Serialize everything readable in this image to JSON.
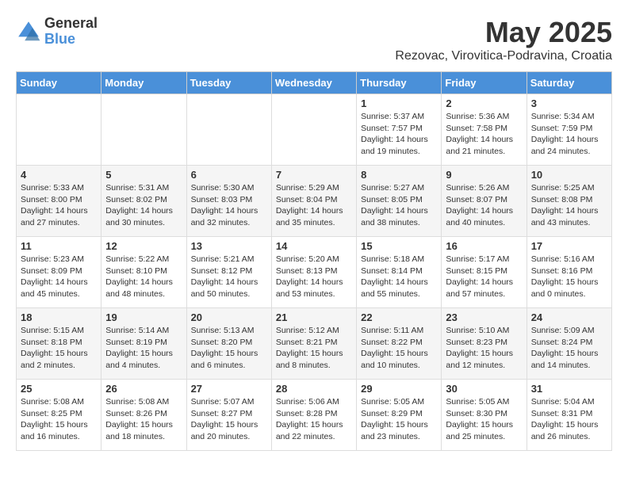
{
  "logo": {
    "general": "General",
    "blue": "Blue"
  },
  "title": "May 2025",
  "subtitle": "Rezovac, Virovitica-Podravina, Croatia",
  "headers": [
    "Sunday",
    "Monday",
    "Tuesday",
    "Wednesday",
    "Thursday",
    "Friday",
    "Saturday"
  ],
  "weeks": [
    [
      {
        "day": "",
        "info": ""
      },
      {
        "day": "",
        "info": ""
      },
      {
        "day": "",
        "info": ""
      },
      {
        "day": "",
        "info": ""
      },
      {
        "day": "1",
        "info": "Sunrise: 5:37 AM\nSunset: 7:57 PM\nDaylight: 14 hours\nand 19 minutes."
      },
      {
        "day": "2",
        "info": "Sunrise: 5:36 AM\nSunset: 7:58 PM\nDaylight: 14 hours\nand 21 minutes."
      },
      {
        "day": "3",
        "info": "Sunrise: 5:34 AM\nSunset: 7:59 PM\nDaylight: 14 hours\nand 24 minutes."
      }
    ],
    [
      {
        "day": "4",
        "info": "Sunrise: 5:33 AM\nSunset: 8:00 PM\nDaylight: 14 hours\nand 27 minutes."
      },
      {
        "day": "5",
        "info": "Sunrise: 5:31 AM\nSunset: 8:02 PM\nDaylight: 14 hours\nand 30 minutes."
      },
      {
        "day": "6",
        "info": "Sunrise: 5:30 AM\nSunset: 8:03 PM\nDaylight: 14 hours\nand 32 minutes."
      },
      {
        "day": "7",
        "info": "Sunrise: 5:29 AM\nSunset: 8:04 PM\nDaylight: 14 hours\nand 35 minutes."
      },
      {
        "day": "8",
        "info": "Sunrise: 5:27 AM\nSunset: 8:05 PM\nDaylight: 14 hours\nand 38 minutes."
      },
      {
        "day": "9",
        "info": "Sunrise: 5:26 AM\nSunset: 8:07 PM\nDaylight: 14 hours\nand 40 minutes."
      },
      {
        "day": "10",
        "info": "Sunrise: 5:25 AM\nSunset: 8:08 PM\nDaylight: 14 hours\nand 43 minutes."
      }
    ],
    [
      {
        "day": "11",
        "info": "Sunrise: 5:23 AM\nSunset: 8:09 PM\nDaylight: 14 hours\nand 45 minutes."
      },
      {
        "day": "12",
        "info": "Sunrise: 5:22 AM\nSunset: 8:10 PM\nDaylight: 14 hours\nand 48 minutes."
      },
      {
        "day": "13",
        "info": "Sunrise: 5:21 AM\nSunset: 8:12 PM\nDaylight: 14 hours\nand 50 minutes."
      },
      {
        "day": "14",
        "info": "Sunrise: 5:20 AM\nSunset: 8:13 PM\nDaylight: 14 hours\nand 53 minutes."
      },
      {
        "day": "15",
        "info": "Sunrise: 5:18 AM\nSunset: 8:14 PM\nDaylight: 14 hours\nand 55 minutes."
      },
      {
        "day": "16",
        "info": "Sunrise: 5:17 AM\nSunset: 8:15 PM\nDaylight: 14 hours\nand 57 minutes."
      },
      {
        "day": "17",
        "info": "Sunrise: 5:16 AM\nSunset: 8:16 PM\nDaylight: 15 hours\nand 0 minutes."
      }
    ],
    [
      {
        "day": "18",
        "info": "Sunrise: 5:15 AM\nSunset: 8:18 PM\nDaylight: 15 hours\nand 2 minutes."
      },
      {
        "day": "19",
        "info": "Sunrise: 5:14 AM\nSunset: 8:19 PM\nDaylight: 15 hours\nand 4 minutes."
      },
      {
        "day": "20",
        "info": "Sunrise: 5:13 AM\nSunset: 8:20 PM\nDaylight: 15 hours\nand 6 minutes."
      },
      {
        "day": "21",
        "info": "Sunrise: 5:12 AM\nSunset: 8:21 PM\nDaylight: 15 hours\nand 8 minutes."
      },
      {
        "day": "22",
        "info": "Sunrise: 5:11 AM\nSunset: 8:22 PM\nDaylight: 15 hours\nand 10 minutes."
      },
      {
        "day": "23",
        "info": "Sunrise: 5:10 AM\nSunset: 8:23 PM\nDaylight: 15 hours\nand 12 minutes."
      },
      {
        "day": "24",
        "info": "Sunrise: 5:09 AM\nSunset: 8:24 PM\nDaylight: 15 hours\nand 14 minutes."
      }
    ],
    [
      {
        "day": "25",
        "info": "Sunrise: 5:08 AM\nSunset: 8:25 PM\nDaylight: 15 hours\nand 16 minutes."
      },
      {
        "day": "26",
        "info": "Sunrise: 5:08 AM\nSunset: 8:26 PM\nDaylight: 15 hours\nand 18 minutes."
      },
      {
        "day": "27",
        "info": "Sunrise: 5:07 AM\nSunset: 8:27 PM\nDaylight: 15 hours\nand 20 minutes."
      },
      {
        "day": "28",
        "info": "Sunrise: 5:06 AM\nSunset: 8:28 PM\nDaylight: 15 hours\nand 22 minutes."
      },
      {
        "day": "29",
        "info": "Sunrise: 5:05 AM\nSunset: 8:29 PM\nDaylight: 15 hours\nand 23 minutes."
      },
      {
        "day": "30",
        "info": "Sunrise: 5:05 AM\nSunset: 8:30 PM\nDaylight: 15 hours\nand 25 minutes."
      },
      {
        "day": "31",
        "info": "Sunrise: 5:04 AM\nSunset: 8:31 PM\nDaylight: 15 hours\nand 26 minutes."
      }
    ]
  ]
}
